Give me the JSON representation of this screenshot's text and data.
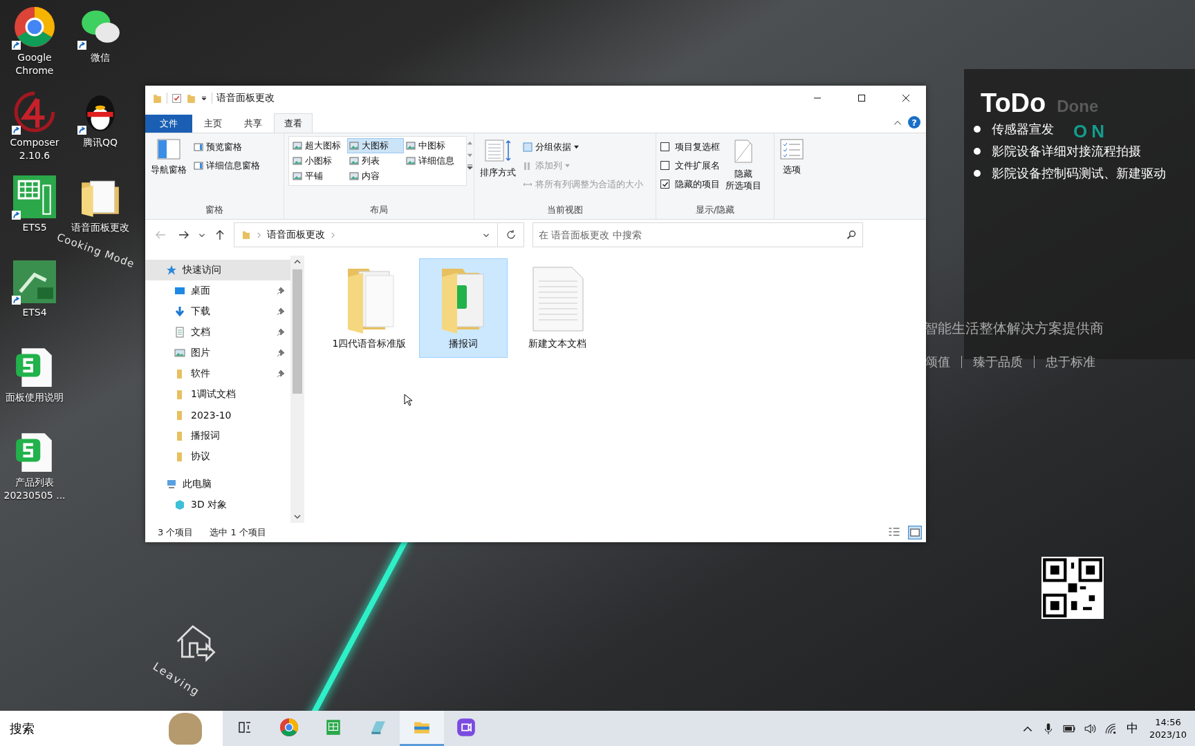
{
  "desktop_icons": [
    {
      "label": "Google\nChrome",
      "kind": "chrome",
      "shortcut": true
    },
    {
      "label": "微信",
      "kind": "wechat",
      "shortcut": true
    },
    {
      "label": "Composer\n2.10.6",
      "kind": "composer",
      "shortcut": true
    },
    {
      "label": "腾讯QQ",
      "kind": "qq",
      "shortcut": true
    },
    {
      "label": "ETS5",
      "kind": "ets5",
      "shortcut": true
    },
    {
      "label": "语音面板更改",
      "kind": "folder",
      "shortcut": false
    },
    {
      "label": "ETS4",
      "kind": "ets4",
      "shortcut": true
    },
    {
      "label": "面板使用说明",
      "kind": "sheet",
      "shortcut": false
    },
    {
      "label": "产品列表\n20230505 ...",
      "kind": "sheet",
      "shortcut": false
    }
  ],
  "wallpaper": {
    "mode_labels": [
      "Cooking Mode",
      "Leaving"
    ],
    "slogan": "智能生活整体解决方案提供商",
    "values": [
      "颂值",
      "臻于品质",
      "忠于标准"
    ],
    "logo_fragment": "ON"
  },
  "explorer": {
    "title": "语音面板更改",
    "help": "?",
    "file_tab": "文件",
    "tabs": [
      {
        "label": "主页",
        "selected": false
      },
      {
        "label": "共享",
        "selected": false
      },
      {
        "label": "查看",
        "selected": true
      }
    ],
    "ribbon": {
      "pane": {
        "nav_pane": "导航窗格",
        "preview": "预览窗格",
        "details": "详细信息窗格",
        "group": "窗格"
      },
      "layout": {
        "options": [
          {
            "label": "超大图标",
            "selected": false
          },
          {
            "label": "大图标",
            "selected": true
          },
          {
            "label": "中图标",
            "selected": false
          },
          {
            "label": "小图标",
            "selected": false
          },
          {
            "label": "列表",
            "selected": false
          },
          {
            "label": "详细信息",
            "selected": false
          },
          {
            "label": "平铺",
            "selected": false
          },
          {
            "label": "内容",
            "selected": false
          }
        ],
        "group": "布局"
      },
      "current_view": {
        "sort": "排序方式",
        "group_by": "分组依据",
        "add_column": "添加列",
        "fit_columns": "将所有列调整为合适的大小",
        "group": "当前视图"
      },
      "show_hide": {
        "checkboxes": [
          {
            "label": "项目复选框",
            "checked": false
          },
          {
            "label": "文件扩展名",
            "checked": false
          },
          {
            "label": "隐藏的项目",
            "checked": true
          }
        ],
        "hide_selected": [
          "隐藏",
          "所选项目"
        ],
        "group": "显示/隐藏"
      },
      "options": "选项"
    },
    "path": "语音面板更改",
    "search_placeholder": "在 语音面板更改 中搜索",
    "nav": [
      {
        "label": "快速访问",
        "kind": "star",
        "selected": true,
        "children": [
          {
            "label": "桌面",
            "kind": "desktop",
            "pinned": true
          },
          {
            "label": "下载",
            "kind": "download",
            "pinned": true
          },
          {
            "label": "文档",
            "kind": "document",
            "pinned": true
          },
          {
            "label": "图片",
            "kind": "picture",
            "pinned": true
          },
          {
            "label": "软件",
            "kind": "folder",
            "pinned": true
          },
          {
            "label": "1调试文档",
            "kind": "folder",
            "pinned": false
          },
          {
            "label": "2023-10",
            "kind": "folder",
            "pinned": false
          },
          {
            "label": "播报词",
            "kind": "folder",
            "pinned": false
          },
          {
            "label": "协议",
            "kind": "folder",
            "pinned": false
          }
        ]
      },
      {
        "label": "此电脑",
        "kind": "pc",
        "selected": false,
        "children": [
          {
            "label": "3D 对象",
            "kind": "cube",
            "pinned": false
          }
        ]
      }
    ],
    "files": [
      {
        "name": "1四代语音标准版",
        "kind": "folder",
        "selected": false
      },
      {
        "name": "播报词",
        "kind": "sheet-folder",
        "selected": true
      },
      {
        "name": "新建文本文档",
        "kind": "text",
        "selected": false
      }
    ],
    "status": [
      "3 个项目",
      "选中 1 个项目"
    ]
  },
  "todo": {
    "title": "ToDo",
    "done": "Done",
    "items": [
      "传感器宣发",
      "影院设备详细对接流程拍摄",
      "影院设备控制码测试、新建驱动"
    ]
  },
  "taskbar": {
    "search": "搜索",
    "apps": [
      {
        "kind": "taskview",
        "active": false
      },
      {
        "kind": "chrome",
        "active": false
      },
      {
        "kind": "sheet",
        "active": false
      },
      {
        "kind": "notes",
        "active": false
      },
      {
        "kind": "explorer",
        "active": true
      },
      {
        "kind": "video",
        "active": false
      }
    ],
    "ime": "中",
    "time": "14:56",
    "date": "2023/10"
  }
}
